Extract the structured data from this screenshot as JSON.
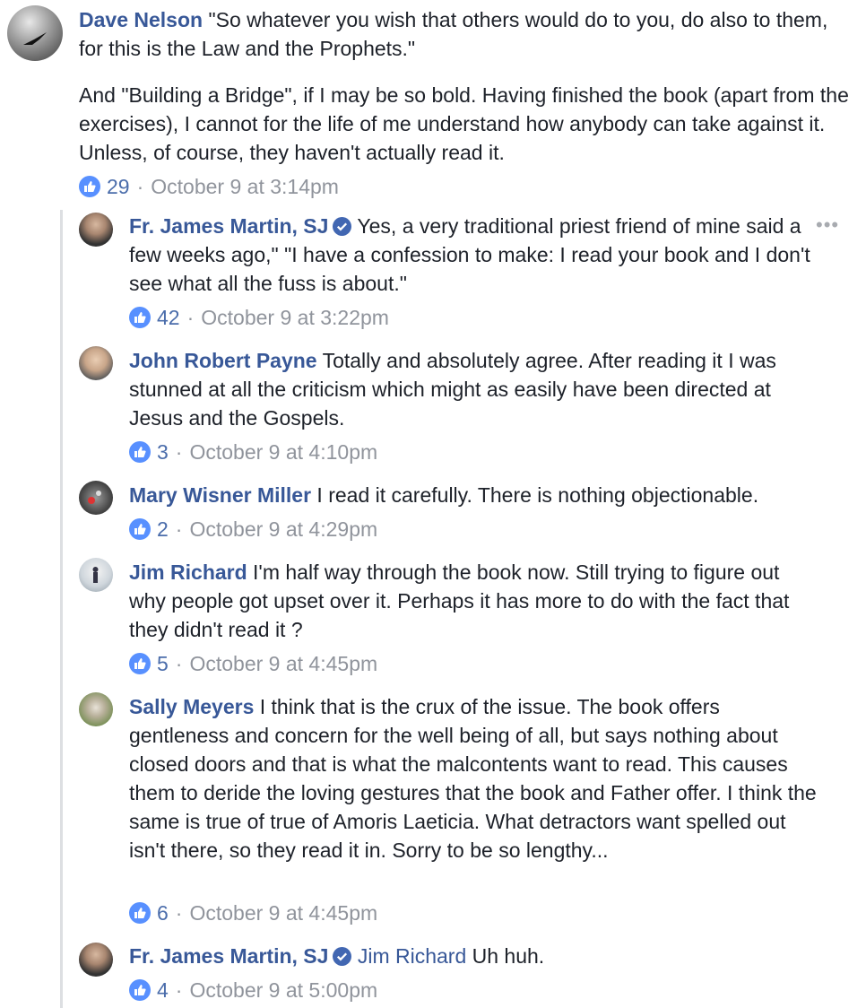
{
  "comment0": {
    "author": "Dave Nelson",
    "text1": " \"So whatever you wish that others would do to you, do also to them, for this is the Law and the Prophets.\"",
    "text2": "And \"Building a Bridge\", if I may be so bold. Having finished the book (apart from the exercises), I cannot for the life of me understand how anybody can take against it. Unless, of course, they haven't actually read it.",
    "likes": "29",
    "time": "October 9 at 3:14pm"
  },
  "more_icon": "•••",
  "replies": [
    {
      "author": "Fr. James Martin, SJ",
      "verified": true,
      "mention": "",
      "text": " Yes, a very traditional priest friend of mine said a few weeks ago,\" \"I have a confession to make: I read your book and I don't see what all the fuss is about.\"",
      "likes": "42",
      "time": "October 9 at 3:22pm"
    },
    {
      "author": "John Robert Payne",
      "verified": false,
      "mention": "",
      "text": " Totally and absolutely agree. After reading it I was stunned at all the criticism which might as easily have been directed at Jesus and the Gospels.",
      "likes": "3",
      "time": "October 9 at 4:10pm"
    },
    {
      "author": "Mary Wisner Miller",
      "verified": false,
      "mention": "",
      "text": " I read it carefully. There is nothing objectionable.",
      "likes": "2",
      "time": "October 9 at 4:29pm"
    },
    {
      "author": "Jim Richard",
      "verified": false,
      "mention": "",
      "text": " I'm half way through the book now. Still trying to figure out why people got upset over it. Perhaps it has more to do with the fact that they didn't read it ?",
      "likes": "5",
      "time": "October 9 at 4:45pm"
    },
    {
      "author": "Sally Meyers",
      "verified": false,
      "mention": "",
      "text": " I think that is the crux of the issue. The book offers gentleness and concern for the well being of all, but says nothing about closed doors and that is what the malcontents want to read. This causes them to deride the loving gestures that the book and Father offer. I think the same is true of true of Amoris Laeticia. What detractors want spelled out isn't there, so they read it in. Sorry to be so lengthy...",
      "likes": "6",
      "time": "October 9 at 4:45pm"
    },
    {
      "author": "Fr. James Martin, SJ",
      "verified": true,
      "mention": "Jim Richard",
      "text": " Uh huh.",
      "likes": "4",
      "time": "October 9 at 5:00pm"
    }
  ],
  "colors": {
    "link": "#385898",
    "meta": "#90949c",
    "like": "#5890ff",
    "text": "#1d2129"
  },
  "icons": {
    "like": "thumbs-up-icon",
    "verified": "verified-badge-icon",
    "more": "more-options-icon"
  }
}
